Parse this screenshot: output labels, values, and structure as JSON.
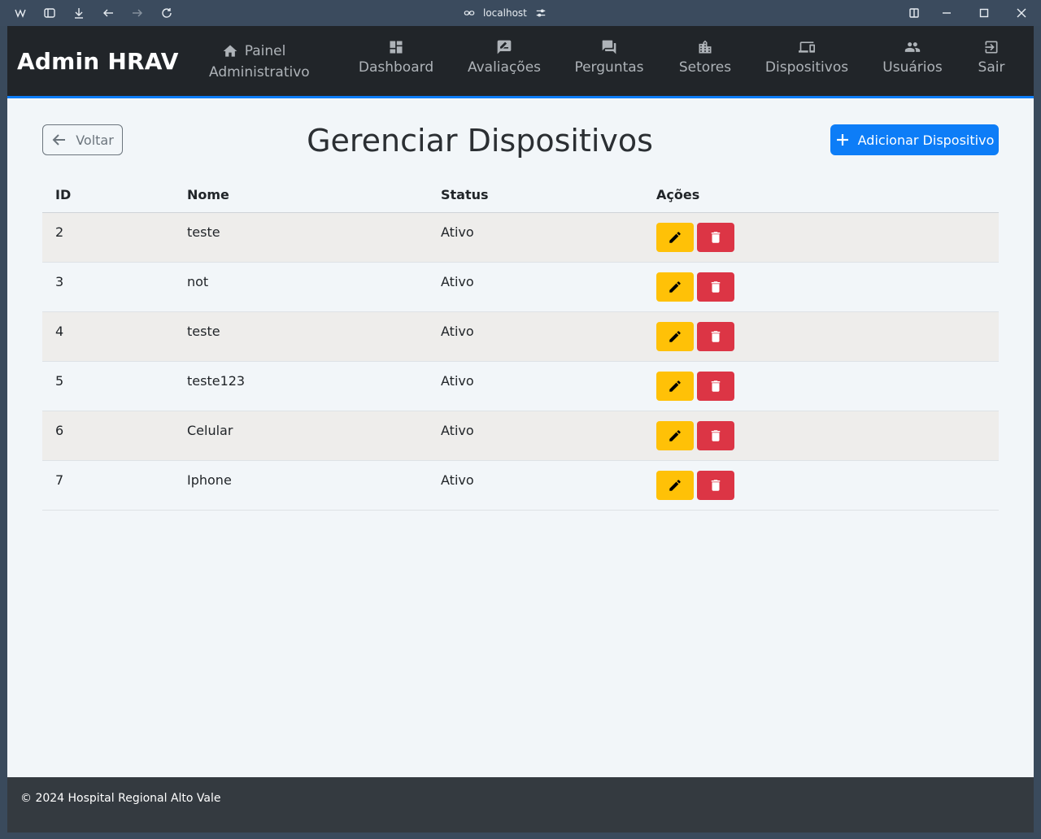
{
  "browser": {
    "address": "localhost",
    "icons": [
      "app-logo-icon",
      "sidebar-toggle-icon",
      "download-icon",
      "back-arrow-icon",
      "forward-arrow-icon",
      "reload-icon",
      "link-icon",
      "site-settings-icon",
      "split-view-icon",
      "minimize-icon",
      "maximize-icon",
      "close-icon"
    ]
  },
  "navbar": {
    "brand": "Admin HRAV",
    "items": [
      {
        "label_line1": "Painel",
        "label_line2": "Administrativo",
        "icon": "home-icon"
      },
      {
        "label": "Dashboard",
        "icon": "dashboard-icon"
      },
      {
        "label": "Avaliações",
        "icon": "rate-review-icon"
      },
      {
        "label": "Perguntas",
        "icon": "forum-icon"
      },
      {
        "label": "Setores",
        "icon": "building-icon"
      },
      {
        "label": "Dispositivos",
        "icon": "devices-icon"
      },
      {
        "label": "Usuários",
        "icon": "people-icon"
      },
      {
        "label": "Sair",
        "icon": "logout-icon"
      }
    ],
    "accent_color": "#0d7df7"
  },
  "page": {
    "back_label": "Voltar",
    "title": "Gerenciar Dispositivos",
    "add_label": "Adicionar Dispositivo"
  },
  "table": {
    "headers": [
      "ID",
      "Nome",
      "Status",
      "Ações"
    ],
    "rows": [
      {
        "id": "2",
        "nome": "teste",
        "status": "Ativo"
      },
      {
        "id": "3",
        "nome": "not",
        "status": "Ativo"
      },
      {
        "id": "4",
        "nome": "teste",
        "status": "Ativo"
      },
      {
        "id": "5",
        "nome": "teste123",
        "status": "Ativo"
      },
      {
        "id": "6",
        "nome": "Celular",
        "status": "Ativo"
      },
      {
        "id": "7",
        "nome": "Iphone",
        "status": "Ativo"
      }
    ],
    "edit_color": "#ffc107",
    "delete_color": "#dc3545"
  },
  "footer": {
    "text": "© 2024 Hospital Regional Alto Vale"
  }
}
